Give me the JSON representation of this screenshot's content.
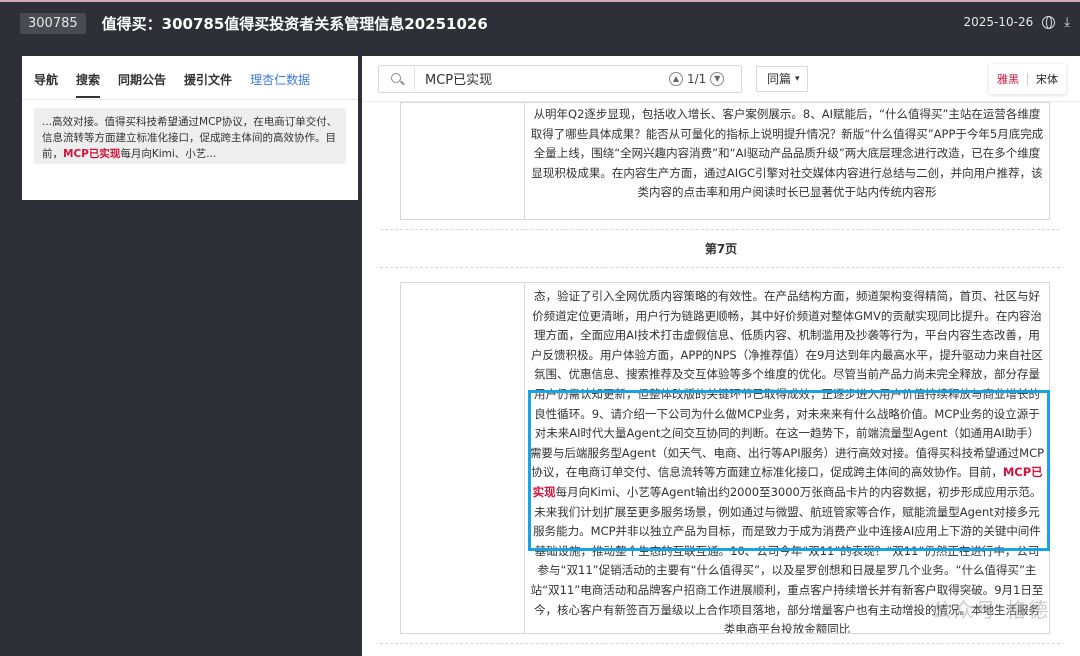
{
  "header": {
    "code": "300785",
    "title": "值得买：300785值得买投资者关系管理信息20251026",
    "date": "2025-10-26"
  },
  "icons": {
    "globe": "globe-icon",
    "download": "download-icon",
    "search": "search-icon"
  },
  "left_panel": {
    "tabs": [
      {
        "label": "导航"
      },
      {
        "label": "搜索"
      },
      {
        "label": "同期公告"
      },
      {
        "label": "援引文件"
      },
      {
        "label": "理杏仁数据"
      }
    ],
    "snippet": {
      "before": "...高效对接。值得买科技希望通过MCP协议，在电商订单交付、信息流转等方面建立标准化接口，促成跨主体间的高效协作。目前，",
      "highlight": "MCP已实现",
      "after": "每月向Kimi、小艺..."
    }
  },
  "toolbar": {
    "search_value": "MCP已实现",
    "match_count": "1/1",
    "layout_select": "同篇",
    "font_options": [
      "雅黑",
      "宋体"
    ]
  },
  "document": {
    "top_text": "从明年Q2逐步显现，包括收入增长、客户案例展示。8、AI赋能后，“什么值得买”主站在运营各维度取得了哪些具体成果？能否从可量化的指标上说明提升情况？新版“什么值得买”APP于今年5月底完成全量上线，围绕“全网兴趣内容消费”和“AI驱动产品品质升级”两大底层理念进行改造，已在多个维度显现积极成果。在内容生产方面，通过AIGC引擎对社交媒体内容进行总结与二创，并向用户推荐，该类内容的点击率和用户阅读时长已显著优于站内传统内容形",
    "page_label": "第7页",
    "main_before": "态，验证了引入全网优质内容策略的有效性。在产品结构方面，频道架构变得精简，首页、社区与好价频道定位更清晰，用户行为链路更顺畅，其中好价频道对整体GMV的贡献实现同比提升。在内容治理方面，全面应用AI技术打击虚假信息、低质内容、机制滥用及抄袭等行为，平台内容生态改善，用户反馈积极。用户体验方面，APP的NPS（净推荐值）在9月达到年内最高水平，提升驱动力来自社区氛围、优惠信息、搜索推荐及交互体验等多个维度的优化。尽管当前产品力尚未完全释放，部分存量用户仍需认知更新，但整体改版的关键环节已取得成效，正逐步进入用户价值持续释放与商业增长的良性循环。9、请介绍一下公司为什么做MCP业务，对未来来有什么战略价值。MCP业务的设立源于对未来AI时代大量Agent之间交互协同的判断。在这一趋势下，前端流量型Agent（如通用AI助手）需要与后端服务型Agent（如天气、电商、出行等API服务）进行高效对接。值得买科技希望通过MCP协议，在电商订单交付、信息流转等方面建立标准化接口，促成跨主体间的高效协作。目前，",
    "main_highlight": "MCP已实现",
    "main_after": "每月向Kimi、小艺等Agent输出约2000至3000万张商品卡片的内容数据，初步形成应用示范。未来我们计划扩展至更多服务场景，例如通过与微盟、航班管家等合作，赋能流量型Agent对接多元服务能力。MCP并非以独立产品为目标，而是致力于成为消费产业中连接AI应用上下游的关键中间件基础设施，推动整个生态的互联互通。10、公司今年“双11”的表现？“双11”仍然正在进行中，公司参与“双11”促销活动的主要有“什么值得买”，以及星罗创想和日晟星罗几个业务。“什么值得买”主站“双11”电商活动和品牌客户招商工作进展顺利，重点客户持续增长并有新客户取得突破。9月1日至今，核心客户有新签百万量级以上合作项目落地，部分增量客户也有主动增投的情况。本地生活服务类电商平台投放金额同比"
  },
  "watermark": "公众号·格德"
}
